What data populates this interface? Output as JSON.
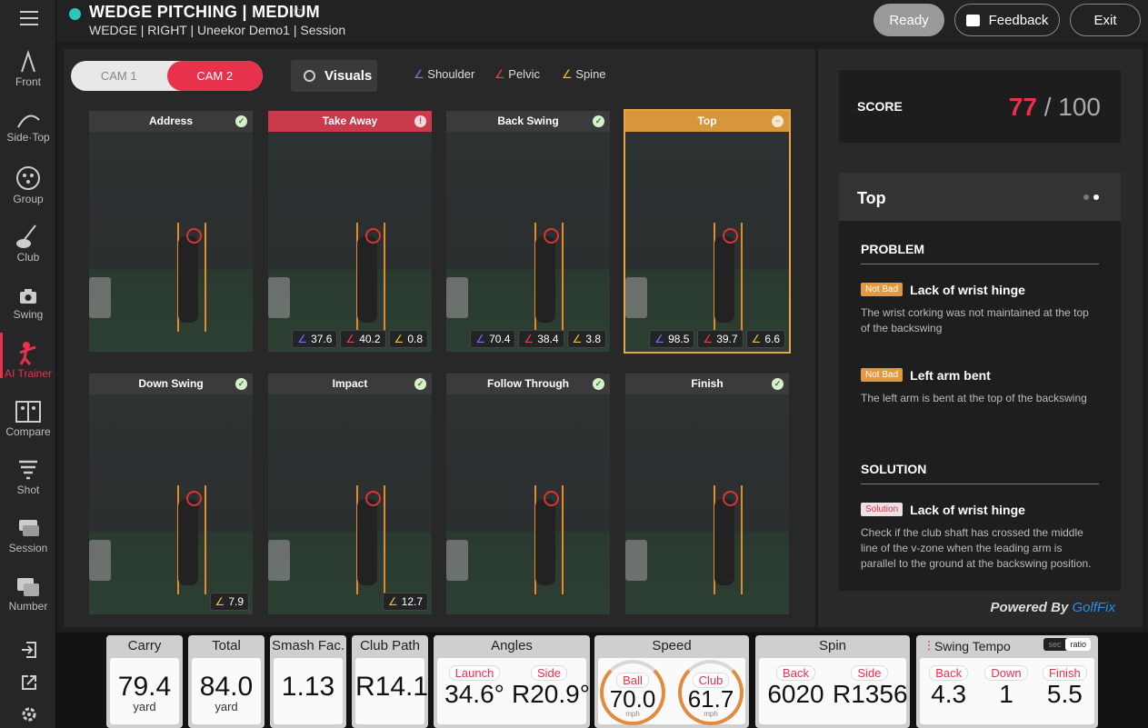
{
  "app": {
    "title": "WEDGE PITCHING | MEDIUM",
    "subtitle": "WEDGE | RIGHT | Uneekor Demo1 | Session"
  },
  "header": {
    "ready_label": "Ready",
    "feedback_label": "Feedback",
    "exit_label": "Exit"
  },
  "sidebar": {
    "items": [
      {
        "label": "Front"
      },
      {
        "label": "Side·Top"
      },
      {
        "label": "Group"
      },
      {
        "label": "Club"
      },
      {
        "label": "Swing"
      },
      {
        "label": "AI Trainer"
      },
      {
        "label": "Compare"
      },
      {
        "label": "Shot"
      },
      {
        "label": "Session"
      },
      {
        "label": "Number"
      }
    ]
  },
  "cams": {
    "cam1": "CAM 1",
    "cam2": "CAM 2",
    "visuals": "Visuals"
  },
  "legend": {
    "shoulder": "Shoulder",
    "pelvic": "Pelvic",
    "spine": "Spine"
  },
  "colors": {
    "shoulder": "#7a6ff0",
    "pelvic": "#e8414a",
    "spine": "#e8c440",
    "accent": "#e8314a"
  },
  "phases": [
    {
      "name": "Address",
      "status": "ok",
      "angles": []
    },
    {
      "name": "Take Away",
      "status": "warn",
      "angles": [
        "37.6",
        "40.2",
        "0.8"
      ]
    },
    {
      "name": "Back Swing",
      "status": "ok",
      "angles": [
        "70.4",
        "38.4",
        "3.8"
      ]
    },
    {
      "name": "Top",
      "status": "neutral",
      "angles": [
        "98.5",
        "39.7",
        "6.6"
      ]
    },
    {
      "name": "Down Swing",
      "status": "ok",
      "angles": [
        "",
        "",
        "7.9"
      ]
    },
    {
      "name": "Impact",
      "status": "ok",
      "angles": [
        "",
        "",
        "12.7"
      ]
    },
    {
      "name": "Follow Through",
      "status": "ok",
      "angles": []
    },
    {
      "name": "Finish",
      "status": "ok",
      "angles": []
    }
  ],
  "score": {
    "label": "SCORE",
    "value": "77",
    "max": "/ 100"
  },
  "panel": {
    "title": "Top",
    "problem_title": "PROBLEM",
    "problems": [
      {
        "tag": "Not Bad",
        "title": "Lack of wrist hinge",
        "desc": "The wrist corking was not maintained at the top of the backswing"
      },
      {
        "tag": "Not Bad",
        "title": "Left arm bent",
        "desc": "The left arm is bent at the top of the backswing"
      }
    ],
    "solution_title": "SOLUTION",
    "solution": {
      "tag": "Solution",
      "title": "Lack of wrist hinge",
      "desc": "Check if the club shaft has crossed the middle line of the v-zone when the leading arm is parallel to the ground at the backswing position."
    },
    "powered": "Powered By",
    "brand": "GolfFix"
  },
  "stats": {
    "carry": {
      "label": "Carry",
      "value": "79.4",
      "unit": "yard"
    },
    "total": {
      "label": "Total",
      "value": "84.0",
      "unit": "yard"
    },
    "smash": {
      "label": "Smash Fac.",
      "value": "1.13"
    },
    "path": {
      "label": "Club Path",
      "value": "R14.1°"
    },
    "angles": {
      "label": "Angles",
      "launch_label": "Launch",
      "launch": "34.6°",
      "side_label": "Side",
      "side": "R20.9°"
    },
    "speed": {
      "label": "Speed",
      "ball_label": "Ball",
      "ball": "70.0",
      "club_label": "Club",
      "club": "61.7",
      "unit": "mph"
    },
    "spin": {
      "label": "Spin",
      "back_label": "Back",
      "back": "6020",
      "side_label": "Side",
      "side": "R1356"
    },
    "tempo": {
      "label": "Swing Tempo",
      "sec": "sec",
      "ratio": "ratio",
      "back_label": "Back",
      "back": "4.3",
      "down_label": "Down",
      "down": "1",
      "finish_label": "Finish",
      "finish": "5.5"
    }
  }
}
